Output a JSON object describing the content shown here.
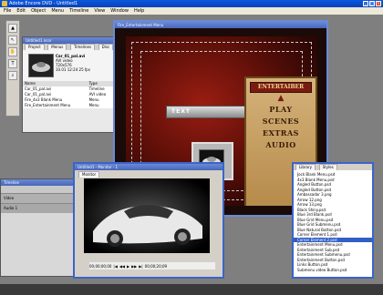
{
  "app": {
    "title": "Adobe Encore DVD - Untitled1"
  },
  "menubar": [
    "File",
    "Edit",
    "Object",
    "Menu",
    "Timeline",
    "View",
    "Window",
    "Help"
  ],
  "toolbox": {
    "tools": [
      "▲",
      "↖",
      "✋",
      "T",
      "⌕"
    ]
  },
  "project_panel": {
    "title": "Untitled1.ncor",
    "tabs": [
      "Project",
      "Menus",
      "Timelines",
      "Disc"
    ],
    "preview": {
      "name": "Car_01_pal.avi",
      "type": "AVI video",
      "size": "720x576",
      "date": "10.01 12:24 25 fps"
    },
    "columns": [
      "Name",
      "Type"
    ],
    "rows": [
      {
        "name": "Car_01_pal.avi",
        "type": "Timeline"
      },
      {
        "name": "Car_01_pal.avi",
        "type": "AVI video"
      },
      {
        "name": "Fire_4x3 Blank Menu",
        "type": "Menu"
      },
      {
        "name": "Fire_Entertainment Menu",
        "type": "Menu"
      }
    ]
  },
  "menu_editor": {
    "title": "Fire_Entertainment Menu",
    "text_button": "TEXT",
    "card_title": "ENTERTAIBER",
    "card_items": [
      "PLAY",
      "SCENES",
      "EXTRAS",
      "AUDIO"
    ]
  },
  "monitor": {
    "title": "Untitled1 - Monitor - 1",
    "tab": "Monitor",
    "timecode": "00;00;00;00",
    "timecode2": "00;00;20;09",
    "controls": [
      "|◀",
      "◀◀",
      "▶",
      "▶▶",
      "▶|"
    ]
  },
  "library": {
    "tabs": [
      "Library",
      "Styles"
    ],
    "items": [
      "Jock Blank Menu.psd",
      "4x3 Blank Menu.psd",
      "Angled Button.psd",
      "Angled Button.psd",
      "Ambassador 3.png",
      "Arrow 12.png",
      "Arrow 13.png",
      "Black Shiny.psd",
      "Blue 3rd Blank.psd",
      "Blue Grid Menu.psd",
      "Blue Grid Submenu.psd",
      "Blue Natural Button.psd",
      "Corner Element 1.psd",
      "Corner Element 2.psd",
      "Entertainment Menu.psd",
      "Entertainment Sub.psd",
      "Entertainment Submenu.psd",
      "Entertainment Button.psd",
      "Links Button.psd",
      "Submenu video Button.psd"
    ],
    "selected_index": 13
  },
  "timeline": {
    "tabs": [
      "Timeline",
      "Audio"
    ],
    "tracks": [
      "Video",
      "Audio 1"
    ]
  },
  "colors": {
    "title_blue": "#0a58e0",
    "menu_red": "#9a1d12",
    "card_gold": "#d4b27a"
  }
}
